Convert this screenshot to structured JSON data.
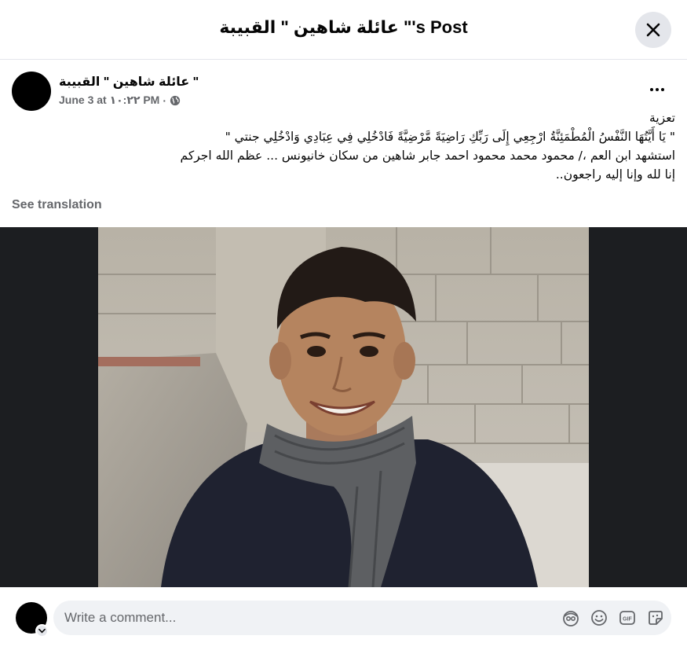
{
  "header": {
    "title": "عائلة شاهين \" القبيبة \"'s Post",
    "close_icon": "close-icon"
  },
  "post": {
    "author": "عائلة شاهين \" القبيبة \"",
    "date": "June 3 at ١٠:٢٢ PM",
    "separator": "·",
    "privacy_icon": "globe-icon",
    "more_icon": "more-options-icon",
    "lines": [
      "تعزية",
      "\" يَا أَيَّتُهَا النَّفْسُ الْمُطْمَئِنَّةُ ارْجِعِي إِلَى رَبِّكِ رَاضِيَةً مَّرْضِيَّةً فَادْخُلِي فِي عِبَادِي وَادْخُلِي جنتي \"",
      "استشهد ابن العم ،/ محمود محمد محمود احمد جابر شاهين من سكان خانيونس ... عظم الله اجركم",
      "إنا لله وإنا إليه راجعون.."
    ],
    "see_translation": "See translation"
  },
  "comment": {
    "placeholder": "Write a comment...",
    "icons": [
      "avatar-sticker-icon",
      "emoji-icon",
      "gif-icon",
      "sticker-icon"
    ]
  },
  "colors": {
    "secondary_text": "#65676b",
    "input_bg": "#f0f2f5",
    "photo_bg": "#1c1e21"
  }
}
